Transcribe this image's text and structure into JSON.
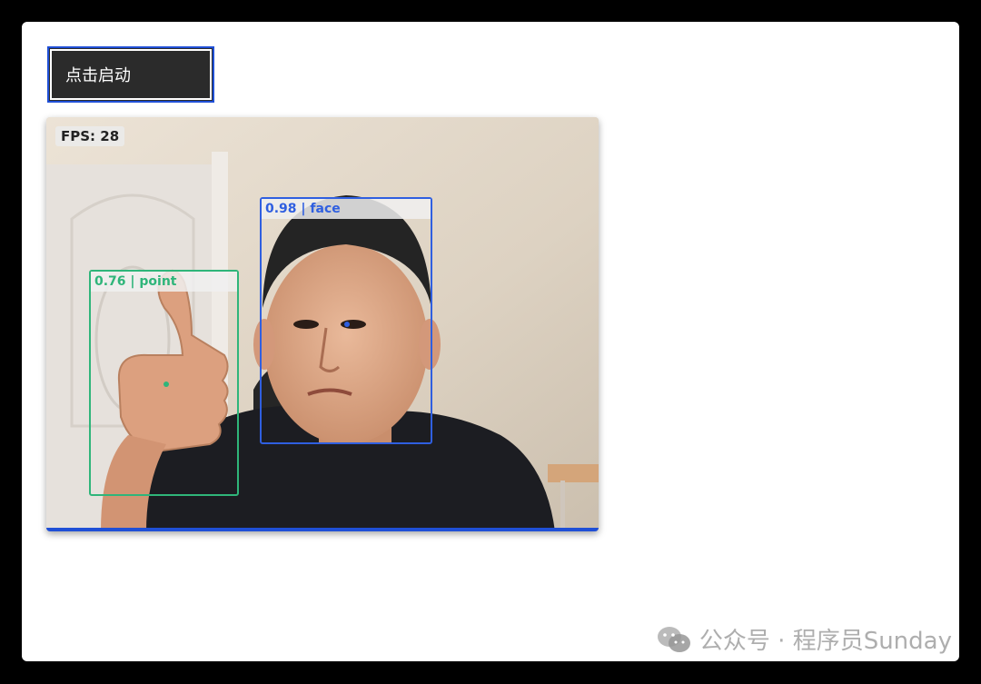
{
  "toolbar": {
    "start_label": "点击启动"
  },
  "video": {
    "fps_text": "FPS: 28",
    "detections": [
      {
        "name": "detection-face",
        "label": "0.98 | face",
        "color": "#2f5fe0"
      },
      {
        "name": "detection-point",
        "label": "0.76 | point",
        "color": "#2fb57a"
      }
    ],
    "progress_fraction": 1.0
  },
  "watermark": {
    "text": "公众号 · 程序员Sunday",
    "icon": "wechat-icon"
  },
  "colors": {
    "accent": "#1f4fd6",
    "face_box": "#2f5fe0",
    "point_box": "#2fb57a"
  }
}
